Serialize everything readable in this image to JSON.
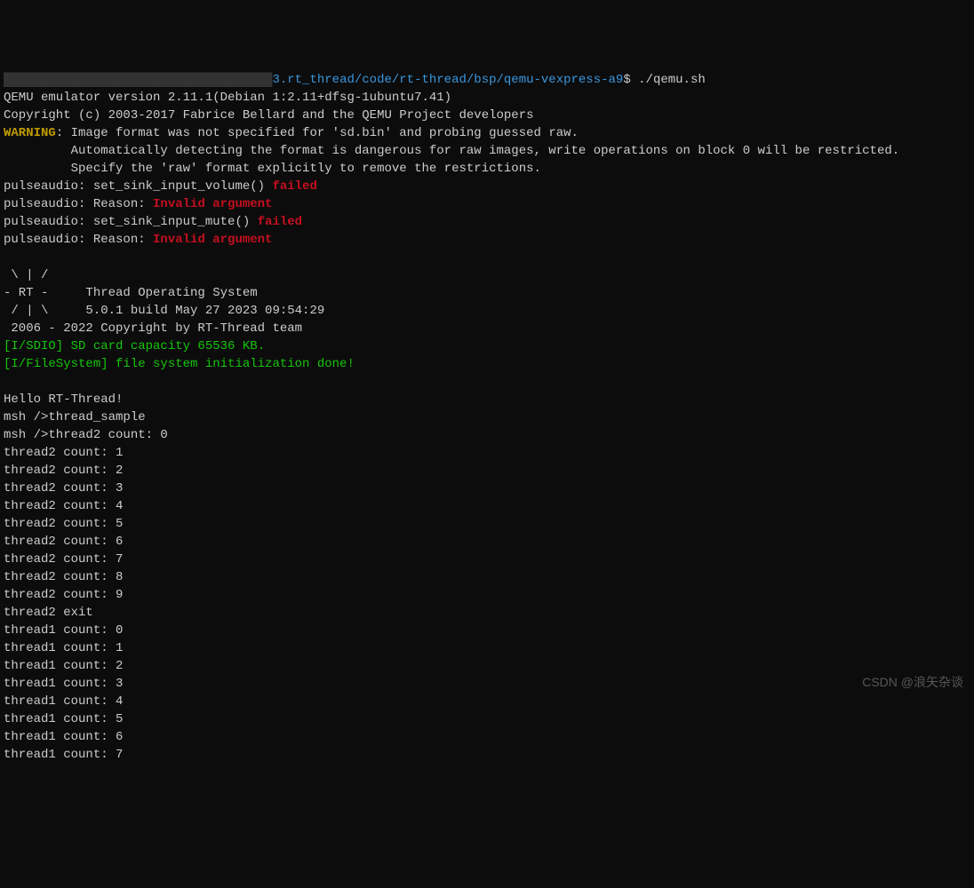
{
  "prompt": {
    "obscured_user_host": "████████████████████████████████████",
    "path": "3.rt_thread/code/rt-thread/bsp/qemu-vexpress-a9",
    "symbol": "$",
    "command": " ./qemu.sh"
  },
  "qemu": {
    "version_line": "QEMU emulator version 2.11.1(Debian 1:2.11+dfsg-1ubuntu7.41)",
    "copyright_line": "Copyright (c) 2003-2017 Fabrice Bellard and the QEMU Project developers"
  },
  "warning": {
    "label": "WARNING",
    "sep": ": ",
    "line1": "Image format was not specified for 'sd.bin' and probing guessed raw.",
    "line2": "         Automatically detecting the format is dangerous for raw images, write operations on block 0 will be restricted.",
    "line3": "         Specify the 'raw' format explicitly to remove the restrictions."
  },
  "pulseaudio": {
    "l1_prefix": "pulseaudio: set_sink_input_volume() ",
    "l1_status": "failed",
    "l2_prefix": "pulseaudio: Reason: ",
    "l2_status": "Invalid argument",
    "l3_prefix": "pulseaudio: set_sink_input_mute() ",
    "l3_status": "failed",
    "l4_prefix": "pulseaudio: Reason: ",
    "l4_status": "Invalid argument"
  },
  "rtthread_logo": {
    "l1": " \\ | /",
    "l2": "- RT -     Thread Operating System",
    "l3": " / | \\     5.0.1 build May 27 2023 09:54:29",
    "l4": " 2006 - 2022 Copyright by RT-Thread team"
  },
  "init": {
    "sdio": "[I/SDIO] SD card capacity 65536 KB.",
    "fs": "[I/FileSystem] file system initialization done!"
  },
  "hello": "Hello RT-Thread!",
  "msh": {
    "cmd_line": "msh />thread_sample",
    "thread2_first": "msh />thread2 count: 0",
    "thread2_lines": [
      "thread2 count: 1",
      "thread2 count: 2",
      "thread2 count: 3",
      "thread2 count: 4",
      "thread2 count: 5",
      "thread2 count: 6",
      "thread2 count: 7",
      "thread2 count: 8",
      "thread2 count: 9",
      "thread2 exit"
    ],
    "thread1_lines": [
      "thread1 count: 0",
      "thread1 count: 1",
      "thread1 count: 2",
      "thread1 count: 3",
      "thread1 count: 4",
      "thread1 count: 5",
      "thread1 count: 6",
      "thread1 count: 7"
    ]
  },
  "watermark": "CSDN @浪矢杂谈"
}
